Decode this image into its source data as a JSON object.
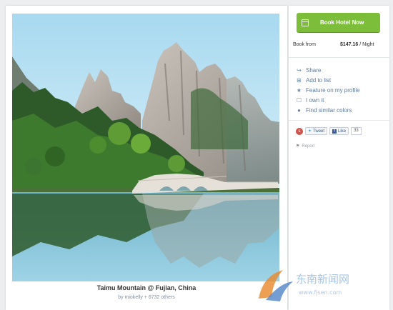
{
  "photo": {
    "title": "Taimu Mountain @ Fujian, China",
    "credit_prefix": "by",
    "author": "miokelly",
    "credit_suffix": "+ 6732 others"
  },
  "sidebar": {
    "book_button": "Book Hotel Now",
    "book_from_label": "Book from",
    "price": "$147.16",
    "price_unit": "/ Night",
    "actions": [
      {
        "label": "Share",
        "icon": "share-icon"
      },
      {
        "label": "Add to list",
        "icon": "list-icon"
      },
      {
        "label": "Feature on my profile",
        "icon": "star-icon"
      },
      {
        "label": "I own it",
        "icon": "own-icon"
      },
      {
        "label": "Find similar colors",
        "icon": "drop-icon"
      }
    ],
    "social": {
      "tweet": "Tweet",
      "like": "Like",
      "like_count": "33"
    },
    "report": "Report"
  },
  "watermark": {
    "text": "东南新闻网",
    "sub": "www.fjsen.com"
  },
  "colors": {
    "accent_green": "#7cbd3a",
    "link_blue": "#5d7a9b"
  }
}
